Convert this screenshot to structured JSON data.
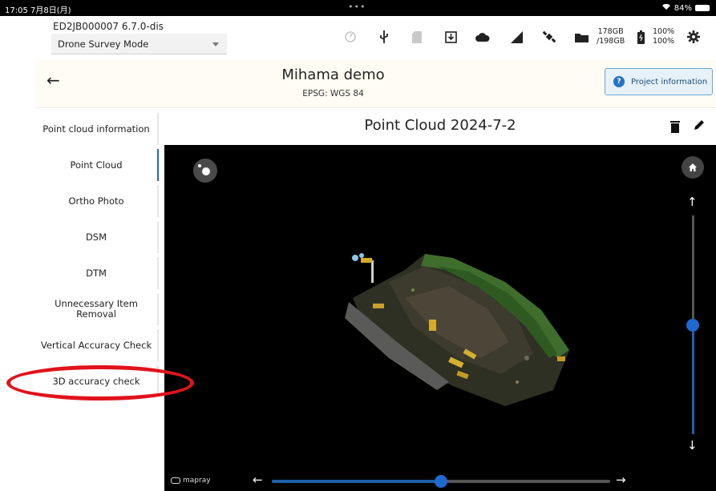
{
  "status_bar": {
    "time": "17:05  7月8日(月)",
    "dots": "•••",
    "battery_text": "84%"
  },
  "device": {
    "id_version": "ED2JB000007    6.7.0-dis",
    "mode_selected": "Drone Survey Mode",
    "storage_used": "178GB",
    "storage_total": "/198GB",
    "battery_1": "100%",
    "battery_2": "100%",
    "icons": [
      "sync-icon",
      "usb-icon",
      "sd-card-icon",
      "download-icon",
      "cloud-icon",
      "signal-icon",
      "satellite-icon",
      "folder-icon",
      "battery-icon",
      "settings-icon"
    ]
  },
  "project": {
    "title": "Mihama demo",
    "subtitle": "EPSG: WGS 84",
    "info_button": "Project information"
  },
  "sidebar": {
    "items": [
      {
        "label": "Point cloud information",
        "active": false
      },
      {
        "label": "Point Cloud",
        "active": true
      },
      {
        "label": "Ortho Photo",
        "active": false
      },
      {
        "label": "DSM",
        "active": false
      },
      {
        "label": "DTM",
        "active": false
      },
      {
        "label": "Unnecessary Item Removal",
        "active": false
      },
      {
        "label": "Vertical Accuracy Check",
        "active": false
      },
      {
        "label": "3D accuracy check",
        "active": false
      }
    ]
  },
  "content": {
    "title": "Point Cloud 2024-7-2"
  },
  "viewer": {
    "logo_text": "mapray",
    "vertical_slider_fraction": 0.5,
    "horizontal_slider_fraction": 0.5
  },
  "colors": {
    "accent": "#1e6ad0",
    "annotation": "#e0131b",
    "header_bg": "#fffdf3"
  }
}
